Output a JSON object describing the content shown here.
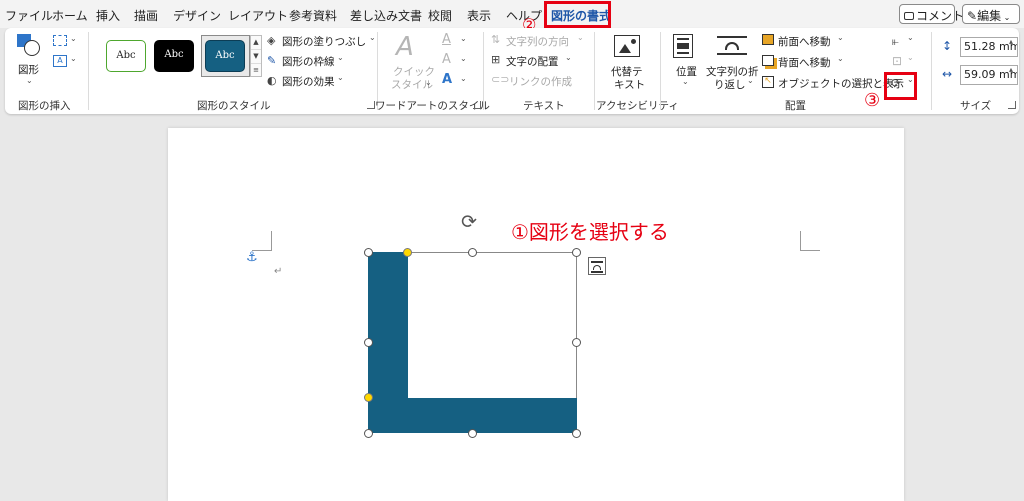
{
  "tabs": [
    "ファイル",
    "ホーム",
    "挿入",
    "描画",
    "デザイン",
    "レイアウト",
    "参考資料",
    "差し込み文書",
    "校閲",
    "表示",
    "ヘルプ",
    "図形の書式"
  ],
  "active_tab": "図形の書式",
  "top_right": {
    "comment": "コメント",
    "edit": "編集"
  },
  "callouts": {
    "step1": "①図形を選択する",
    "step2": "②",
    "step3": "③"
  },
  "ribbon": {
    "insert_shapes": {
      "shape_label": "図形",
      "group_label": "図形の挿入"
    },
    "shape_styles": {
      "styles": [
        "Abc",
        "Abc",
        "Abc"
      ],
      "fill": "図形の塗りつぶし",
      "outline": "図形の枠線",
      "effects": "図形の効果",
      "group_label": "図形のスタイル"
    },
    "wordart": {
      "quick_style_line1": "クイック",
      "quick_style_line2": "スタイル",
      "group_label": "ワードアートのスタイル"
    },
    "text": {
      "direction": "文字列の方向",
      "align": "文字の配置",
      "link": "リンクの作成",
      "group_label": "テキスト"
    },
    "accessibility": {
      "alt_line1": "代替テ",
      "alt_line2": "キスト",
      "group_label": "アクセシビリティ"
    },
    "arrange": {
      "position": "位置",
      "wrap_line1": "文字列の折",
      "wrap_line2": "り返し",
      "bring_forward": "前面へ移動",
      "send_backward": "背面へ移動",
      "selection_pane": "オブジェクトの選択と表示",
      "group_label": "配置"
    },
    "size": {
      "height": "51.28 mm",
      "width": "59.09 mm",
      "group_label": "サイズ"
    }
  },
  "colors": {
    "accent": "#1e56a8",
    "shape_fill": "#156082",
    "annotation_red": "#e60012"
  }
}
